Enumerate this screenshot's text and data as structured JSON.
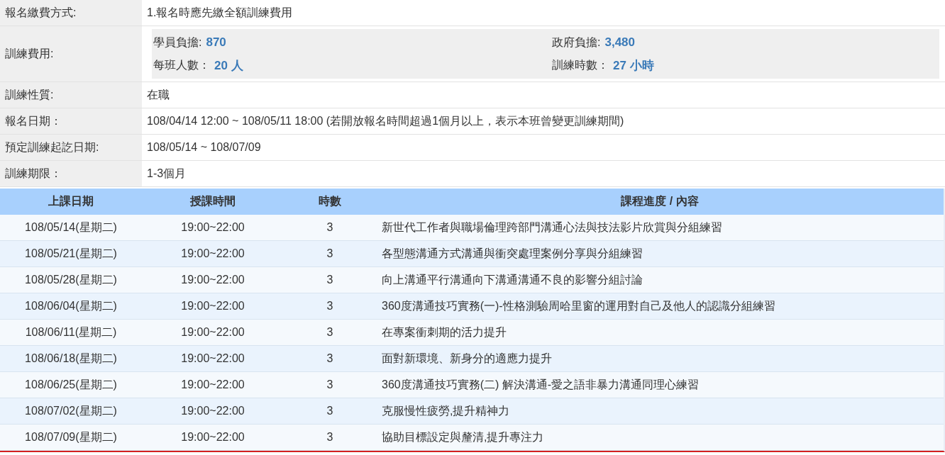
{
  "info": [
    {
      "kind": "text",
      "label": "報名繳費方式:",
      "value": "1.報名時應先繳全額訓練費用"
    },
    {
      "kind": "fees",
      "label": "訓練費用:",
      "fees": [
        {
          "label": "學員負擔:",
          "value": "870"
        },
        {
          "label": "政府負擔:",
          "value": "3,480"
        },
        {
          "label": "每班人數：",
          "value": "20 人"
        },
        {
          "label": "訓練時數：",
          "value": "27 小時"
        }
      ]
    },
    {
      "kind": "text",
      "label": "訓練性質:",
      "value": "在職"
    },
    {
      "kind": "text",
      "label": "報名日期：",
      "value": "108/04/14 12:00 ~ 108/05/11 18:00 (若開放報名時間超過1個月以上，表示本班曾變更訓練期間)"
    },
    {
      "kind": "text",
      "label": "預定訓練起訖日期:",
      "value": "108/05/14 ~ 108/07/09"
    },
    {
      "kind": "text",
      "label": "訓練期限：",
      "value": "1-3個月"
    }
  ],
  "schedule": {
    "columns": [
      "上課日期",
      "授課時間",
      "時數",
      "課程進度 / 內容"
    ],
    "rows": [
      [
        "108/05/14(星期二)",
        "19:00~22:00",
        "3",
        "新世代工作者與職場倫理跨部門溝通心法與技法影片欣賞與分組練習"
      ],
      [
        "108/05/21(星期二)",
        "19:00~22:00",
        "3",
        "各型態溝通方式溝通與衝突處理案例分享與分組練習"
      ],
      [
        "108/05/28(星期二)",
        "19:00~22:00",
        "3",
        "向上溝通平行溝通向下溝通溝通不良的影響分組討論"
      ],
      [
        "108/06/04(星期二)",
        "19:00~22:00",
        "3",
        "360度溝通技巧實務(一)-性格測驗周哈里窗的運用對自己及他人的認識分組練習"
      ],
      [
        "108/06/11(星期二)",
        "19:00~22:00",
        "3",
        "在專案衝刺期的活力提升"
      ],
      [
        "108/06/18(星期二)",
        "19:00~22:00",
        "3",
        "面對新環境、新身分的適應力提升"
      ],
      [
        "108/06/25(星期二)",
        "19:00~22:00",
        "3",
        "360度溝通技巧實務(二) 解決溝通-愛之語非暴力溝通同理心練習"
      ],
      [
        "108/07/02(星期二)",
        "19:00~22:00",
        "3",
        "克服慢性疲勞,提升精神力"
      ],
      [
        "108/07/09(星期二)",
        "19:00~22:00",
        "3",
        "協助目標設定與釐清,提升專注力"
      ]
    ]
  }
}
